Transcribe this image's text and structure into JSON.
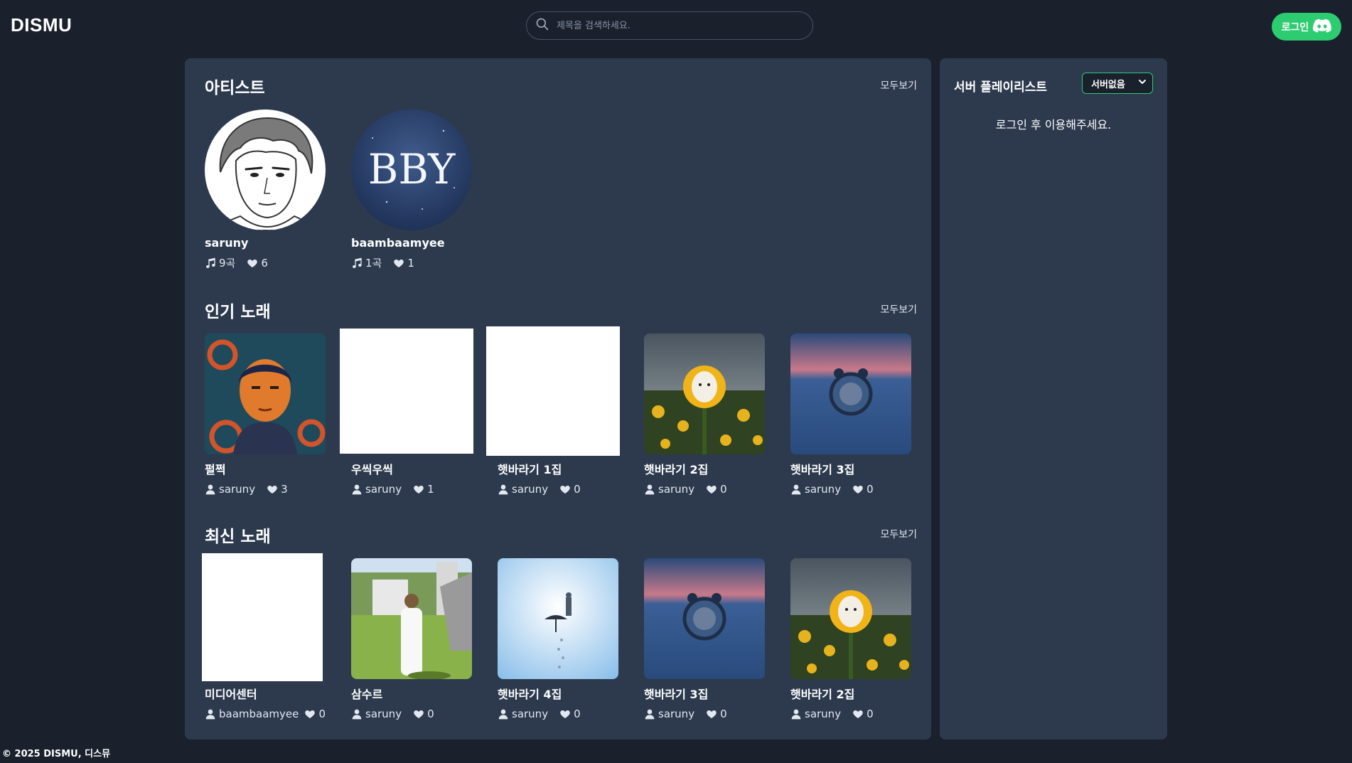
{
  "header": {
    "logo": "DISMU",
    "search_placeholder": "제목을 검색하세요.",
    "login_label": "로그인"
  },
  "sections": {
    "artists": {
      "title": "아티스트",
      "see_all": "모두보기",
      "items": [
        {
          "name": "saruny",
          "songs": "9곡",
          "likes": "6"
        },
        {
          "name": "baambaamyee",
          "songs": "1곡",
          "likes": "1"
        }
      ]
    },
    "popular": {
      "title": "인기 노래",
      "see_all": "모두보기",
      "items": [
        {
          "title": "펄쩍",
          "artist": "saruny",
          "likes": "3"
        },
        {
          "title": "우씩우씩",
          "artist": "saruny",
          "likes": "1"
        },
        {
          "title": "햇바라기 1집",
          "artist": "saruny",
          "likes": "0"
        },
        {
          "title": "햇바라기 2집",
          "artist": "saruny",
          "likes": "0"
        },
        {
          "title": "햇바라기 3집",
          "artist": "saruny",
          "likes": "0"
        }
      ]
    },
    "latest": {
      "title": "최신 노래",
      "see_all": "모두보기",
      "items": [
        {
          "title": "미디어센터",
          "artist": "baambaamyee",
          "likes": "0"
        },
        {
          "title": "삼수르",
          "artist": "saruny",
          "likes": "0"
        },
        {
          "title": "햇바라기 4집",
          "artist": "saruny",
          "likes": "0"
        },
        {
          "title": "햇바라기 3집",
          "artist": "saruny",
          "likes": "0"
        },
        {
          "title": "햇바라기 2집",
          "artist": "saruny",
          "likes": "0"
        }
      ]
    }
  },
  "sidebar": {
    "title": "서버 플레이리스트",
    "server_select": "서버없음",
    "message": "로그인 후 이용해주세요."
  },
  "artwork": {
    "bby_logo_text": "BBY"
  },
  "footer": {
    "copyright": "© 2025 DISMU, 디스뮤"
  },
  "colors": {
    "background": "#1a202c",
    "panel": "#2d3a4e",
    "accent": "#2ecc71"
  },
  "icons": {
    "search": "search-icon",
    "discord": "discord-icon",
    "music": "music-note-icon",
    "heart": "heart-icon",
    "user": "user-icon",
    "chevron": "chevron-down-icon"
  }
}
